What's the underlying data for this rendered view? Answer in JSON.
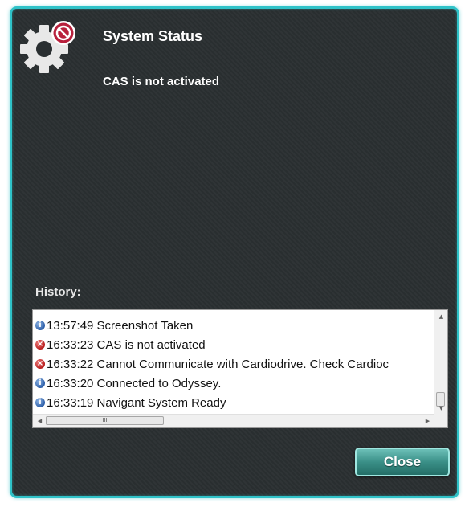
{
  "dialog": {
    "title": "System Status",
    "message": "CAS is not activated",
    "status_icon": "gear-error-icon",
    "accent_color": "#2fc2c8",
    "background_color": "#2a2f31"
  },
  "history": {
    "label": "History:",
    "items": [
      {
        "type": "info",
        "icon": "info-icon",
        "glyph": "i",
        "text": "13:57:49 Screenshot Taken"
      },
      {
        "type": "error",
        "icon": "error-icon",
        "glyph": "×",
        "text": "16:33:23 CAS is not activated"
      },
      {
        "type": "error",
        "icon": "error-icon",
        "glyph": "×",
        "text": "16:33:22 Cannot Communicate with Cardiodrive. Check Cardioc"
      },
      {
        "type": "info",
        "icon": "info-icon",
        "glyph": "i",
        "text": "16:33:20 Connected to Odyssey."
      },
      {
        "type": "info",
        "icon": "info-icon",
        "glyph": "i",
        "text": "16:33:19 Navigant System Ready"
      }
    ],
    "scroll": {
      "up_glyph": "▲",
      "down_glyph": "▼",
      "left_glyph": "◀",
      "right_glyph": "▶",
      "thumb_grip": "III"
    }
  },
  "buttons": {
    "close_label": "Close",
    "close_color": "#3a8f87"
  }
}
